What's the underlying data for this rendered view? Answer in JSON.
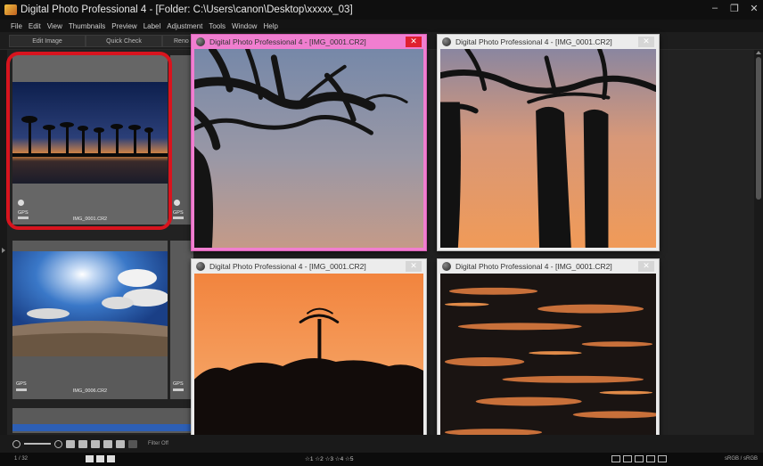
{
  "app": {
    "title": "Digital Photo Professional 4 - [Folder: C:\\Users\\canon\\Desktop\\xxxxx_03]",
    "controls": {
      "minimize": "–",
      "restore": "❐",
      "close": "✕"
    }
  },
  "menu": [
    "File",
    "Edit",
    "View",
    "Thumbnails",
    "Preview",
    "Label",
    "Adjustment",
    "Tools",
    "Window",
    "Help"
  ],
  "tabs": [
    "Edit Image",
    "Quick Check",
    "Reno"
  ],
  "thumbnails": [
    {
      "name": "IMG_0001.CR2",
      "gps": "GPS"
    },
    {
      "name": "IMG_0006.CR2",
      "gps": "GPS"
    },
    {
      "gps_col2a": "GPS",
      "gps_col2b": "GPS"
    }
  ],
  "toolbar": {
    "filter_label": "Filter  Off"
  },
  "status": {
    "counter": "1 / 32",
    "ratings": "☆1 ☆2 ☆3 ☆4 ☆5",
    "colorspace": "sRGB / sRGB"
  },
  "windows": [
    {
      "title": "Digital Photo Professional 4 - [IMG_0001.CR2]",
      "close": "✕",
      "active": true
    },
    {
      "title": "Digital Photo Professional 4 - [IMG_0001.CR2]",
      "close": "✕",
      "active": false
    },
    {
      "title": "Digital Photo Professional 4 - [IMG_0001.CR2]",
      "close": "✕",
      "active": false
    },
    {
      "title": "Digital Photo Professional 4 - [IMG_0001.CR2]",
      "close": "✕",
      "active": false
    }
  ],
  "colors": {
    "selection": "#d8141e",
    "active_window": "#f07ed0",
    "inactive_window": "#ececec"
  }
}
